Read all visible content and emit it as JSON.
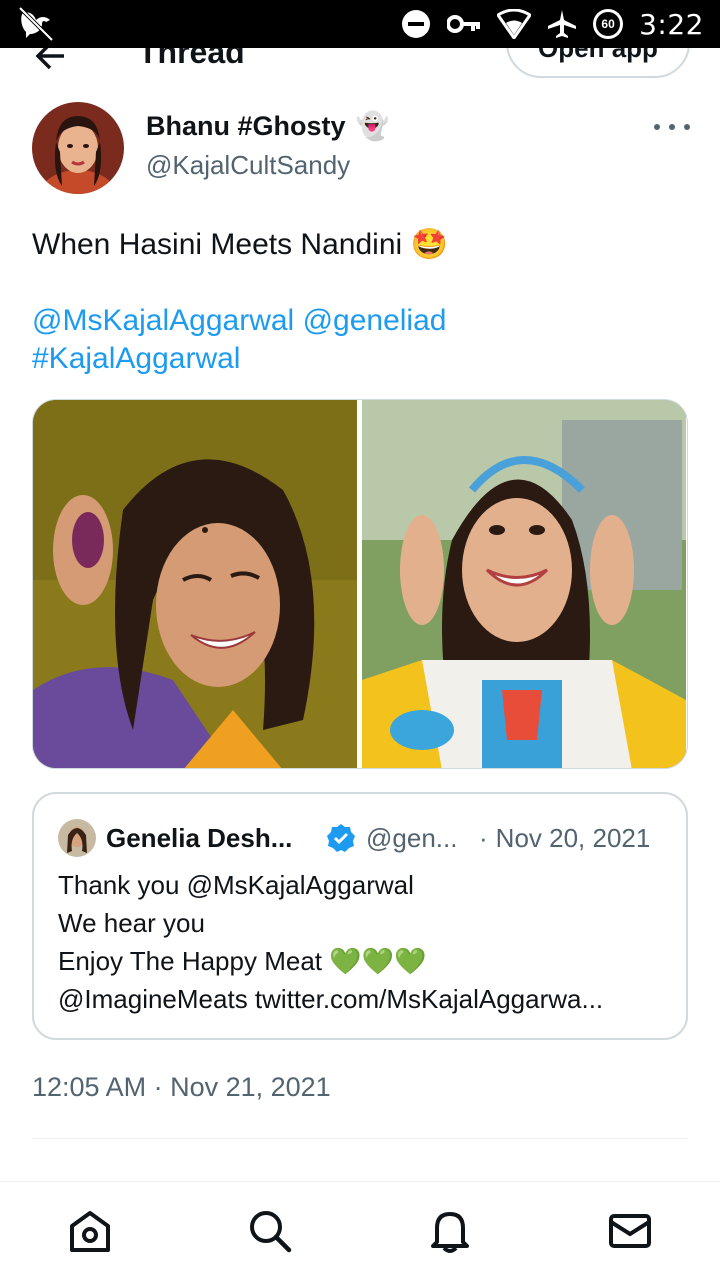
{
  "status_bar": {
    "time": "3:22",
    "battery_level": "60"
  },
  "topbar": {
    "title": "Thread",
    "open_app_label": "Open app"
  },
  "tweet": {
    "display_name": "Bhanu #Ghosty",
    "name_emoji": "👻",
    "handle": "@KajalCultSandy",
    "text": "When Hasini Meets Nandini",
    "text_emoji": "🤩",
    "mention_1": "@MsKajalAggarwal",
    "mention_2": "@geneliad",
    "hashtag": "#KajalAggarwal",
    "timestamp": "12:05 AM · Nov 21, 2021"
  },
  "quote": {
    "name": "Genelia Desh...",
    "handle": "@gen...",
    "separator": "·",
    "date": "Nov 20, 2021",
    "line1": "Thank you @MsKajalAggarwal",
    "line2": "We hear you",
    "line3": "Enjoy The Happy Meat 💚💚💚",
    "line4": "@ImagineMeats twitter.com/MsKajalAggarwa..."
  },
  "colors": {
    "link": "#1d9bf0",
    "secondary": "#536471",
    "border": "#cfd9de"
  },
  "icons": {
    "status": [
      "app-logo-icon",
      "dnd-icon",
      "vpn-key-icon",
      "wifi-icon",
      "airplane-icon",
      "battery-icon"
    ],
    "nav": [
      "home-icon",
      "search-icon",
      "notifications-icon",
      "messages-icon"
    ]
  }
}
